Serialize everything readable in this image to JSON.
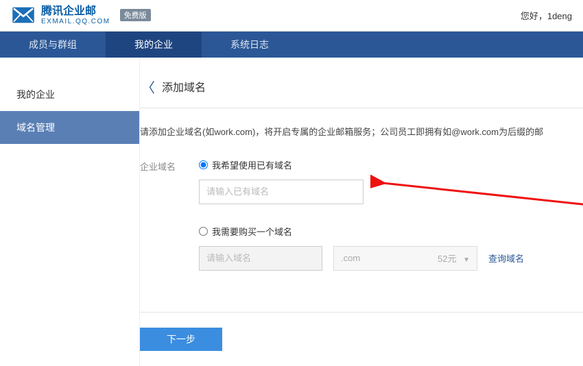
{
  "header": {
    "brand_cn": "腾讯企业邮",
    "brand_en": "EXMAIL.QQ.COM",
    "free_badge": "免费版",
    "greeting_prefix": "您好，",
    "username": "1deng"
  },
  "topnav": {
    "members": "成员与群组",
    "my_enterprise": "我的企业",
    "syslog": "系统日志"
  },
  "sidebar": {
    "my_enterprise": "我的企业",
    "domain_mgmt": "域名管理"
  },
  "page": {
    "title": "添加域名",
    "intro": "请添加企业域名(如work.com)，将开启专属的企业邮箱服务；公司员工即拥有如@work.com为后缀的邮",
    "field_label": "企业域名",
    "option_existing": "我希望使用已有域名",
    "existing_placeholder": "请输入已有域名",
    "option_buy": "我需要购买一个域名",
    "buy_placeholder": "请输入域名",
    "tld": ".com",
    "tld_price": "52元",
    "query_domain": "查询域名",
    "next_btn": "下一步"
  }
}
